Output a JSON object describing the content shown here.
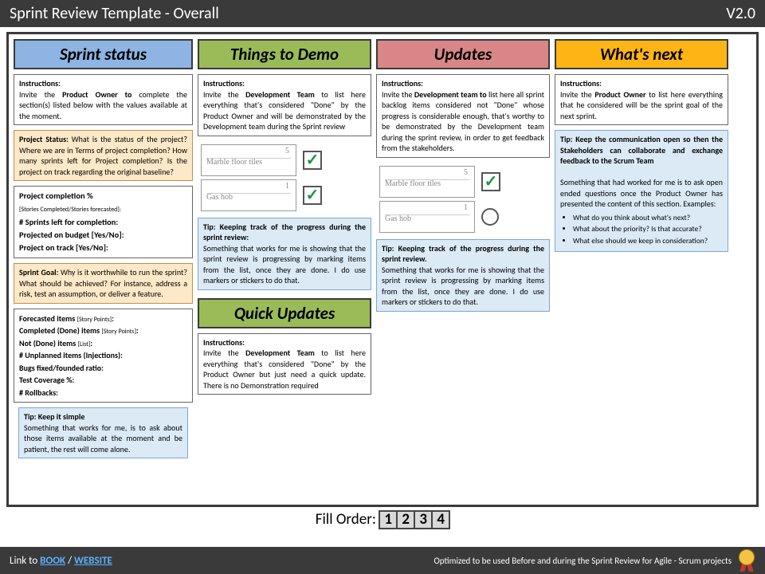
{
  "header": {
    "title": "Sprint Review Template - Overall",
    "version": "V2.0"
  },
  "cols": {
    "status": {
      "title": "Sprint status",
      "instr": "Instructions:",
      "instr_body": "Invite the Product Owner to complete the section(s) listed below with the values available at the moment.",
      "projstatus_label": "Project Status:",
      "projstatus_body": " What is the status of the project? Where we are in Terms of project completion? How many sprints left for Project completion? Is the project on track regarding the original baseline?",
      "f1": "Project completion %",
      "f1s": "[Stories Completed/Stories forecasted]:",
      "f2": "# Sprints left for completion:",
      "f3": "Projected on budget [Yes/No]:",
      "f4": "Project on track [Yes/No]:",
      "goal_label": "Sprint Goal:",
      "goal_body": " Why is it worthwhile to run the sprint? What should be achieved? For instance, address a risk, test an assumption, or deliver a feature.",
      "g1": "Forecasted items [Story Points]:",
      "g2": "Completed (Done) items [Story Points]:",
      "g3": "Not (Done) items [List]:",
      "g4": "# Unplanned items (Injections):",
      "g5": "Bugs fixed/founded ratio:",
      "g6": "Test Coverage %:",
      "g7": "# Rollbacks:",
      "tip_label": "Tip:  Keep it simple",
      "tip_body": "Something that works for me, is to ask about those items available at the moment and be patient, the rest will come alone."
    },
    "demo": {
      "title": "Things to Demo",
      "instr": "Instructions:",
      "instr_body": "Invite the Development Team to list here everything that's considered \"Done\" by the Product Owner and will be demonstrated by the Development team during the Sprint review",
      "card1_num": "5",
      "card1_lbl": "Marble floor tiles",
      "card2_num": "1",
      "card2_lbl": "Gas hob",
      "tip_label": "Tip: Keeping track of the progress during the sprint review:",
      "tip_body": "Something that works for me is showing that the sprint review is progressing by marking items from the list, once they are done. I do use markers or stickers to do that.",
      "quick_title": "Quick Updates",
      "quick_instr": "Instructions:",
      "quick_body": "Invite the Development Team to list here everything that's considered \"Done\" by the Product Owner but just need a quick update. There is no Demonstration required"
    },
    "updates": {
      "title": "Updates",
      "instr": "Instructions:",
      "instr_body": "Invite the Development team to list here all sprint backlog items considered not \"Done\" whose progress is considerable enough, that's worthy to be demonstrated by the Development team during the sprint review, in order to get feedback from the stakeholders.",
      "card1_num": "5",
      "card1_lbl": "Marble floor tiles",
      "card2_num": "1",
      "card2_lbl": "Gas hob",
      "tip_label": "Tip: Keeping track of the progress during the sprint review.",
      "tip_body": "Something that works for me is showing that the sprint review is progressing by marking items from the list, once they are done. I do use markers or stickers to do that."
    },
    "next": {
      "title": "What's next",
      "instr": "Instructions:",
      "instr_body": "Invite the Product Owner to list here everything that he considered will be the sprint goal of the next sprint.",
      "tip_label": "Tip: Keep the communication open so then the Stakeholders can collaborate and exchange feedback to the Scrum Team",
      "tip_body": "Something that had worked for me is to ask open ended questions once the Product Owner has presented the content of this section. Examples:",
      "q1": "What do you think about what's next?",
      "q2": "What about the priority? Is that accurate?",
      "q3": "What else should we keep in consideration?"
    }
  },
  "fillorder": {
    "label": "Fill Order:",
    "n1": "1",
    "n2": "2",
    "n3": "3",
    "n4": "4"
  },
  "footer": {
    "prefix": "Link to ",
    "book": "BOOK",
    "sep": " / ",
    "website": "WEBSITE",
    "right": "Optimized to be used  Before and during the Sprint Review for Agile - Scrum projects"
  }
}
